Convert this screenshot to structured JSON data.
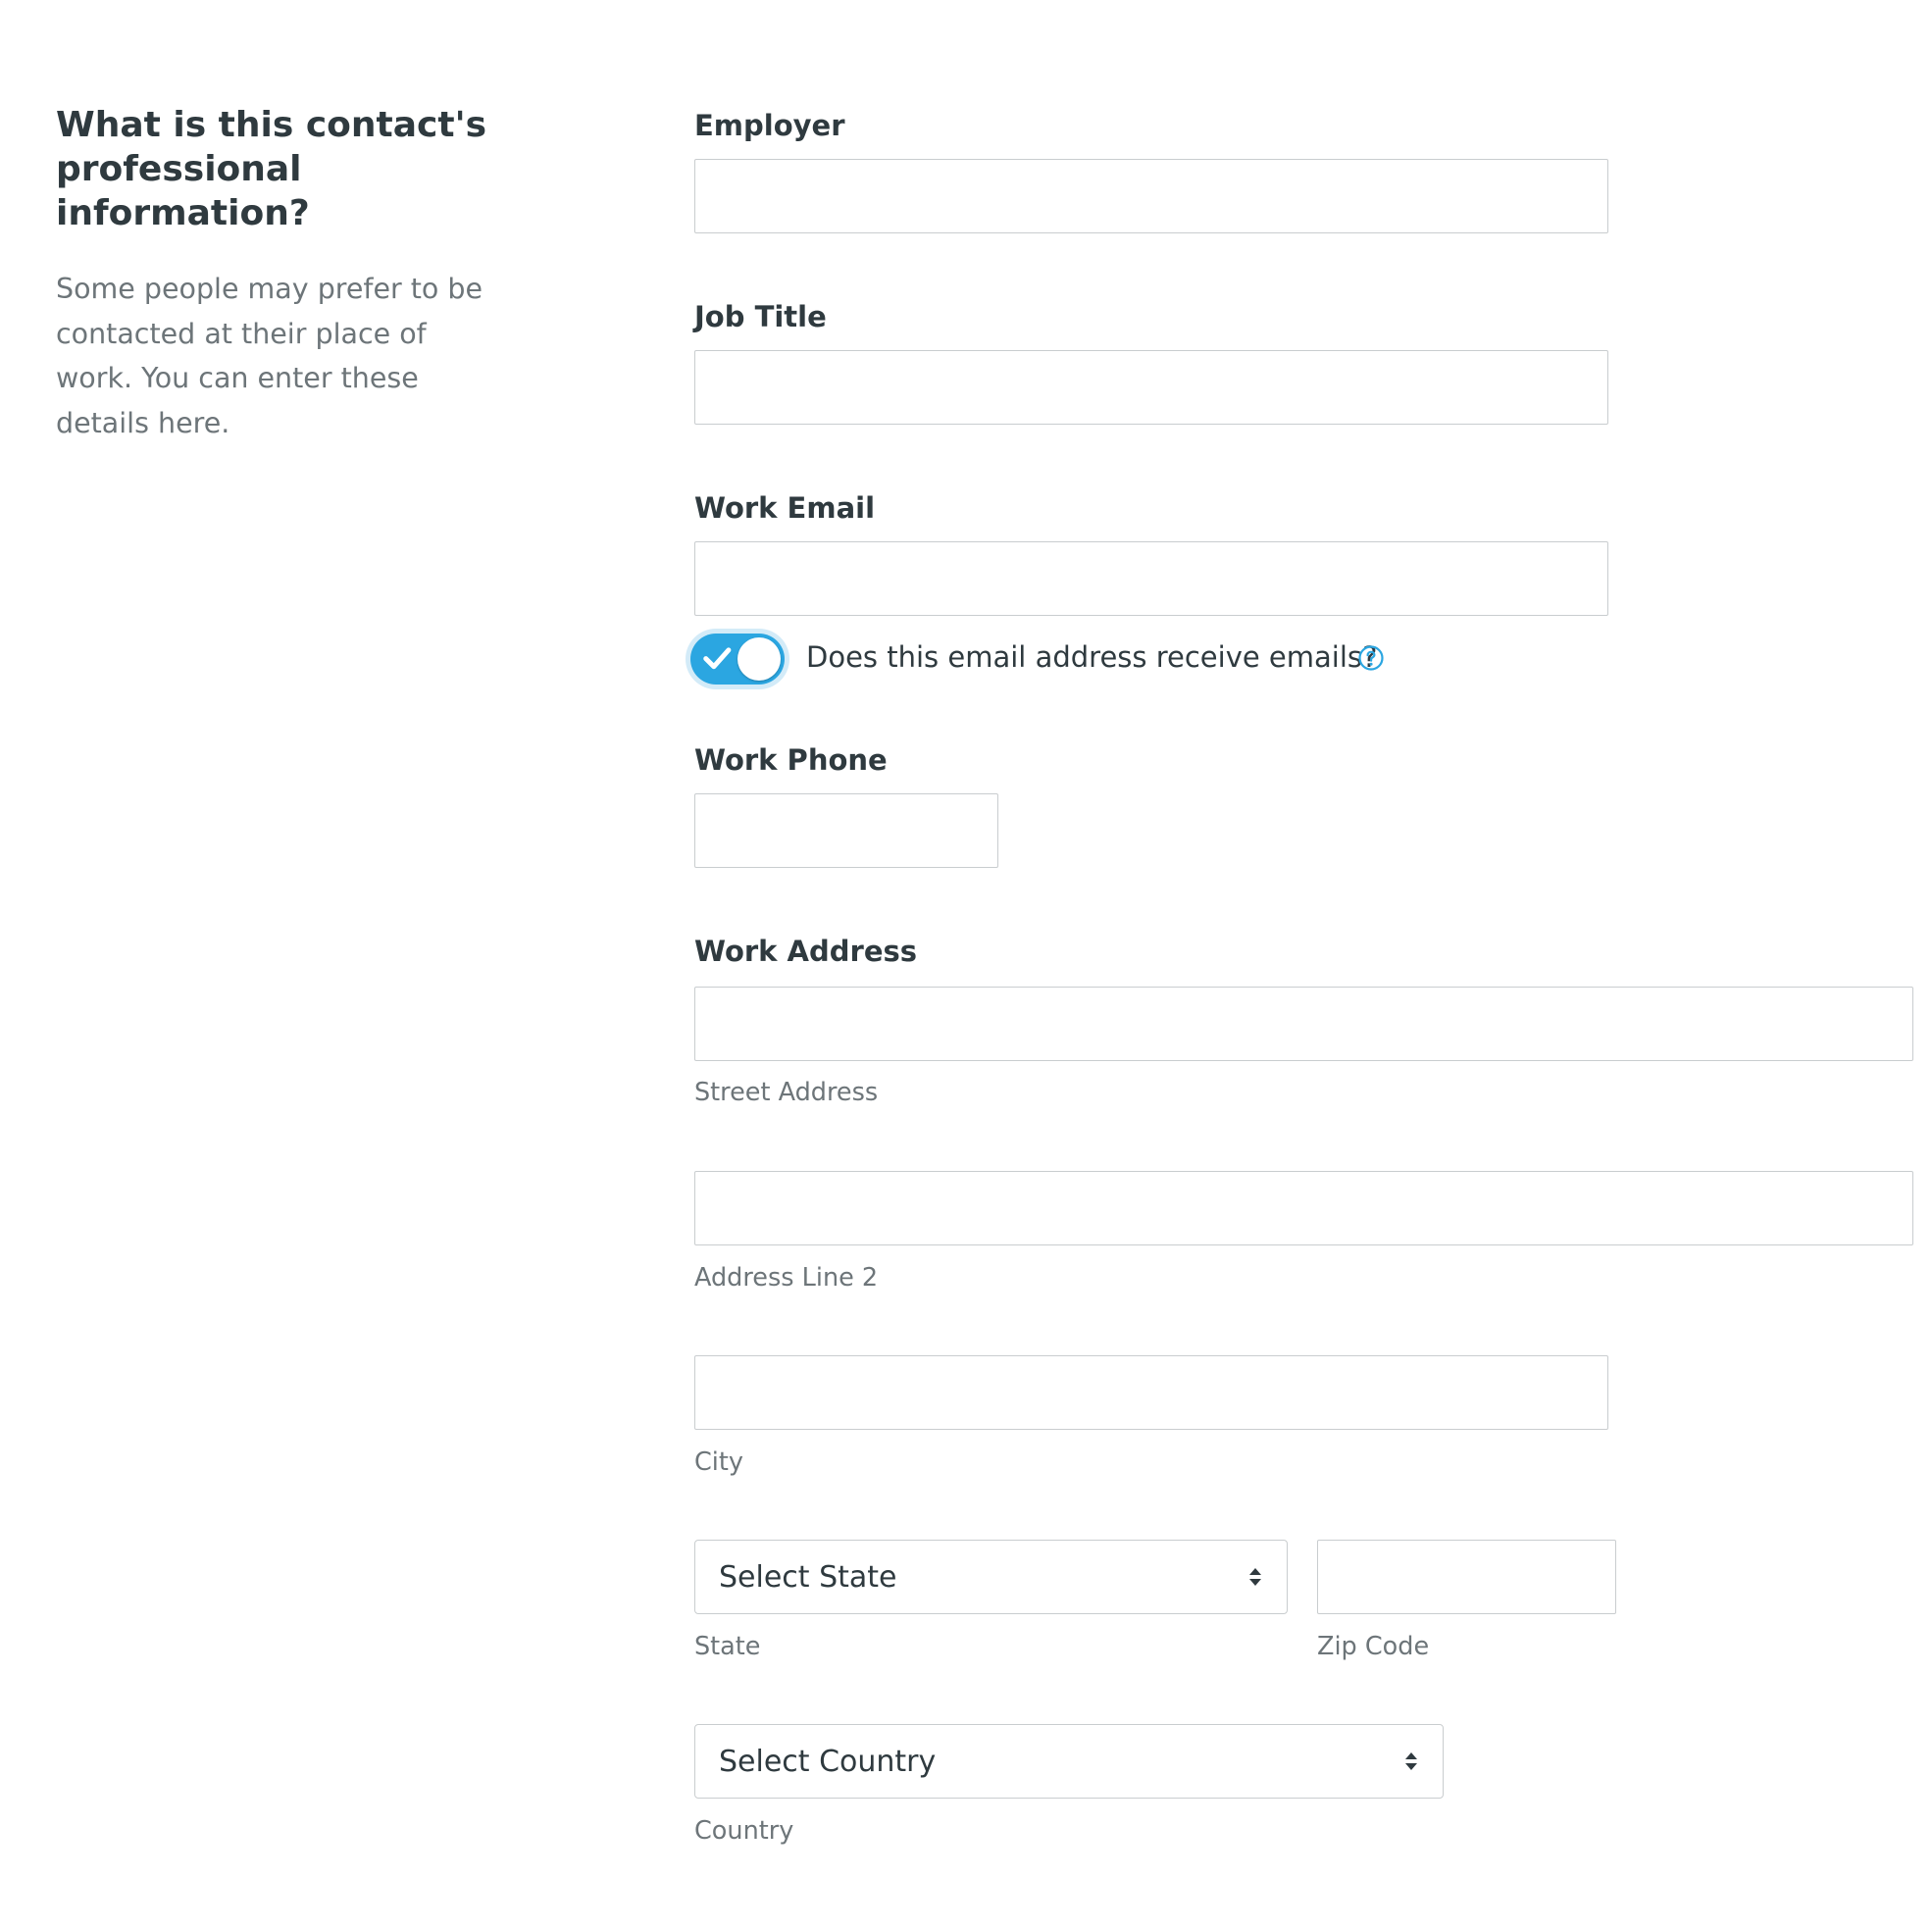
{
  "intro": {
    "heading": "What is this contact's professional information?",
    "description": "Some people may prefer to be contacted at their place of work. You can enter these details here."
  },
  "fields": {
    "employer": {
      "label": "Employer",
      "value": "",
      "placeholder": ""
    },
    "job_title": {
      "label": "Job Title",
      "value": "",
      "placeholder": ""
    },
    "work_email": {
      "label": "Work Email",
      "value": "",
      "placeholder": ""
    },
    "email_toggle": {
      "label": "Does this email address receive emails?",
      "checked": true,
      "icons": {
        "check": "checkmark-icon",
        "help": "question-circle-icon"
      }
    },
    "work_phone": {
      "label": "Work Phone",
      "value": "",
      "placeholder": ""
    }
  },
  "address": {
    "label": "Work Address",
    "street": {
      "hint": "Street Address",
      "value": ""
    },
    "line2": {
      "hint": "Address Line 2",
      "value": ""
    },
    "city": {
      "hint": "City",
      "value": ""
    },
    "state": {
      "selected": "Select State",
      "hint": "State"
    },
    "zip": {
      "hint": "Zip Code",
      "value": ""
    },
    "country": {
      "selected": "Select Country",
      "hint": "Country"
    }
  },
  "colors": {
    "accent": "#2ba6e1",
    "text": "#2f3a3f",
    "muted": "#6d7579",
    "border": "#c9cdcf"
  }
}
